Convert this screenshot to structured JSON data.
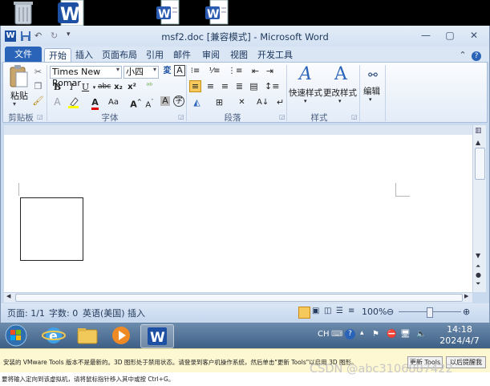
{
  "window": {
    "title": "msf2.doc [兼容模式] - Microsoft Word"
  },
  "tabs": {
    "file": "文件",
    "items": [
      "开始",
      "插入",
      "页面布局",
      "引用",
      "邮件",
      "审阅",
      "视图",
      "开发工具"
    ]
  },
  "ribbon": {
    "paste": "粘贴",
    "font_name": "Times New Romar",
    "font_size": "小四",
    "styles_quick": "快速样式",
    "styles_change": "更改样式",
    "edit": "编辑",
    "groups": {
      "clipboard": "剪贴板",
      "font": "字体",
      "paragraph": "段落",
      "styles": "样式"
    }
  },
  "statusbar": {
    "page": "页面: 1/1",
    "words": "字数: 0",
    "language": "英语(美国)",
    "mode": "插入",
    "zoom": "100%"
  },
  "taskbar": {
    "lang": "CH",
    "time": "14:18",
    "date": "2024/4/7"
  },
  "vmware": {
    "message": "安装的 VMware Tools 版本不是最新的。3D 图形处于禁用状态。请登录到客户机操作系统，然后单击\"更新 Tools\"以启用 3D 图形。",
    "update_button": "更新 Tools",
    "remind_button": "以后提醒我",
    "hint": "要将输入定向到该虚拟机，请将鼠标指针移入其中或按 Ctrl+G。"
  },
  "watermark": "CSDN @abc3106887422",
  "colors": {
    "accent": "#2a64b8",
    "ribbon": "#e3ecf8",
    "taskbar": "#4d6e96"
  }
}
